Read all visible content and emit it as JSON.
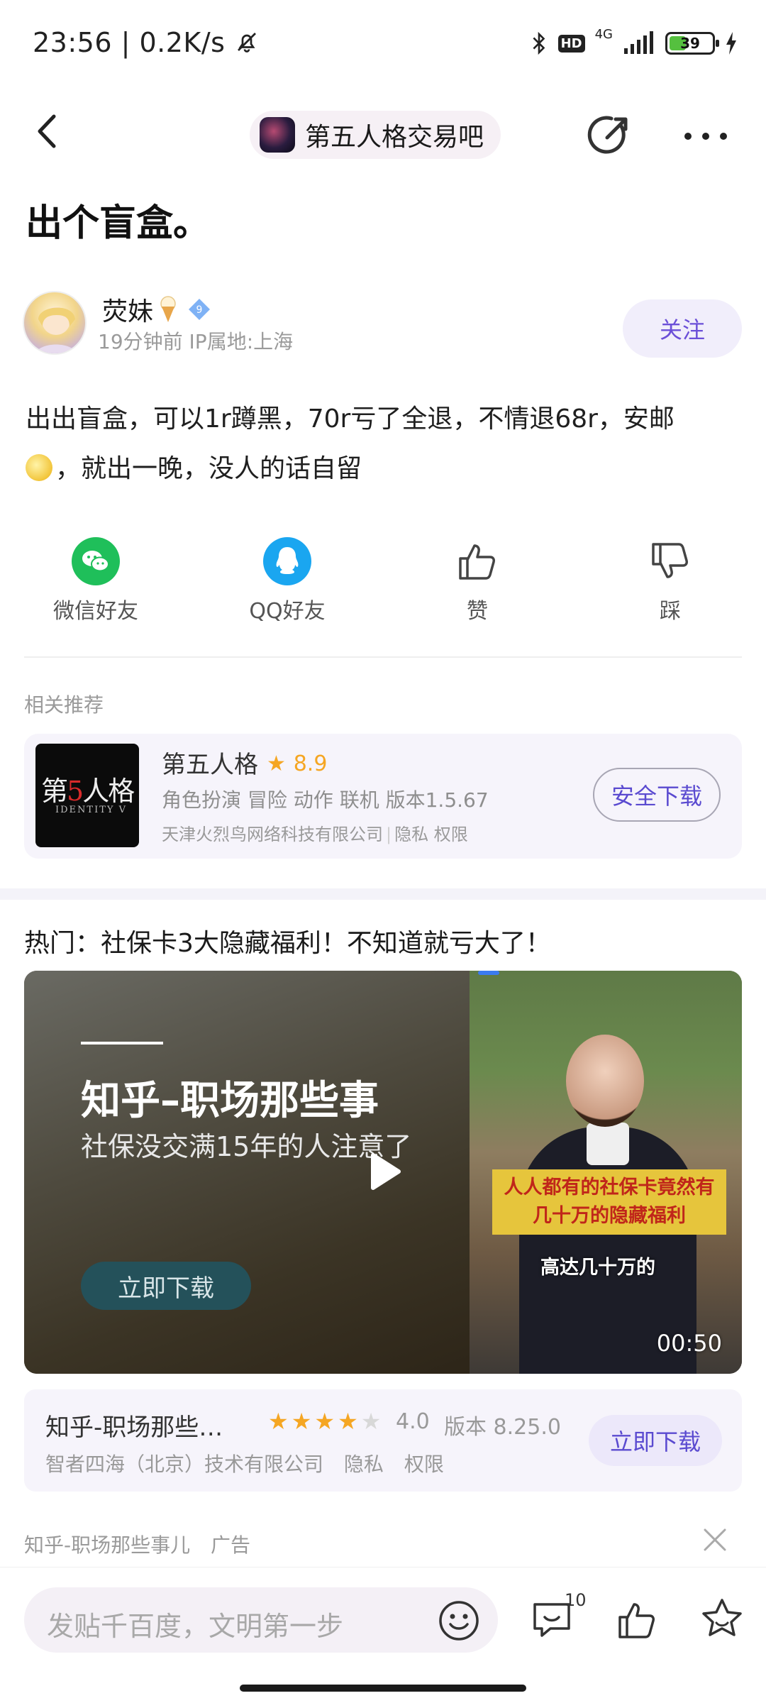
{
  "status_bar": {
    "time": "23:56",
    "net_speed": "0.2K/s",
    "hd_label": "HD",
    "network": "4G",
    "battery": "39",
    "battery_level": 0.39
  },
  "nav": {
    "forum_name": "第五人格交易吧"
  },
  "post": {
    "title": "出个盲盒。",
    "author": {
      "name": "荧妹",
      "level": "9",
      "time_ago": "19分钟前",
      "ip_location": "IP属地:上海",
      "follow_label": "关注"
    },
    "body_line1": "出出盲盒，可以1r蹲黑，70r亏了全退，不情退68r，安邮",
    "body_line2": "，就出一晚，没人的话自留"
  },
  "actions": [
    {
      "label": "微信好友",
      "icon": "wechat-icon"
    },
    {
      "label": "QQ好友",
      "icon": "qq-icon"
    },
    {
      "label": "赞",
      "icon": "thumbs-up-icon"
    },
    {
      "label": "踩",
      "icon": "thumbs-down-icon"
    }
  ],
  "related": {
    "label": "相关推荐",
    "app": {
      "name": "第五人格",
      "rating": "8.9",
      "tags": "角色扮演 冒险 动作 联机  版本1.5.67",
      "company": "天津火烈鸟网络科技有限公司",
      "privacy": "隐私",
      "permissions": "权限",
      "download_label": "安全下载",
      "icon_text_pre": "第",
      "icon_text_five": "5",
      "icon_text_post": "人格",
      "icon_subtext": "IDENTITY V"
    }
  },
  "ad": {
    "title": "热门：社保卡3大隐藏福利！不知道就亏大了！",
    "video": {
      "headline": "知乎–职场那些事",
      "subtitle": "社保没交满15年的人注意了",
      "download_label": "立即下载",
      "caption_yellow": "人人都有的社保卡竟然有几十万的隐藏福利",
      "caption_white": "高达几十万的",
      "duration": "00:50"
    },
    "app": {
      "name": "知乎-职场那些…",
      "stars_on": 4,
      "stars_total": 5,
      "rating": "4.0",
      "version": "版本 8.25.0",
      "company": "智者四海（北京）技术有限公司",
      "privacy": "隐私",
      "permissions": "权限",
      "download_label": "立即下载"
    },
    "footer_name": "知乎-职场那些事儿",
    "footer_tag": "广告"
  },
  "bottom_bar": {
    "comment_placeholder": "发贴千百度，文明第一步",
    "comment_count": "10"
  },
  "colors": {
    "accent": "#6b4fd8",
    "wechat": "#1fbf5a",
    "qq": "#1aa6f0",
    "star": "#f5a623"
  }
}
